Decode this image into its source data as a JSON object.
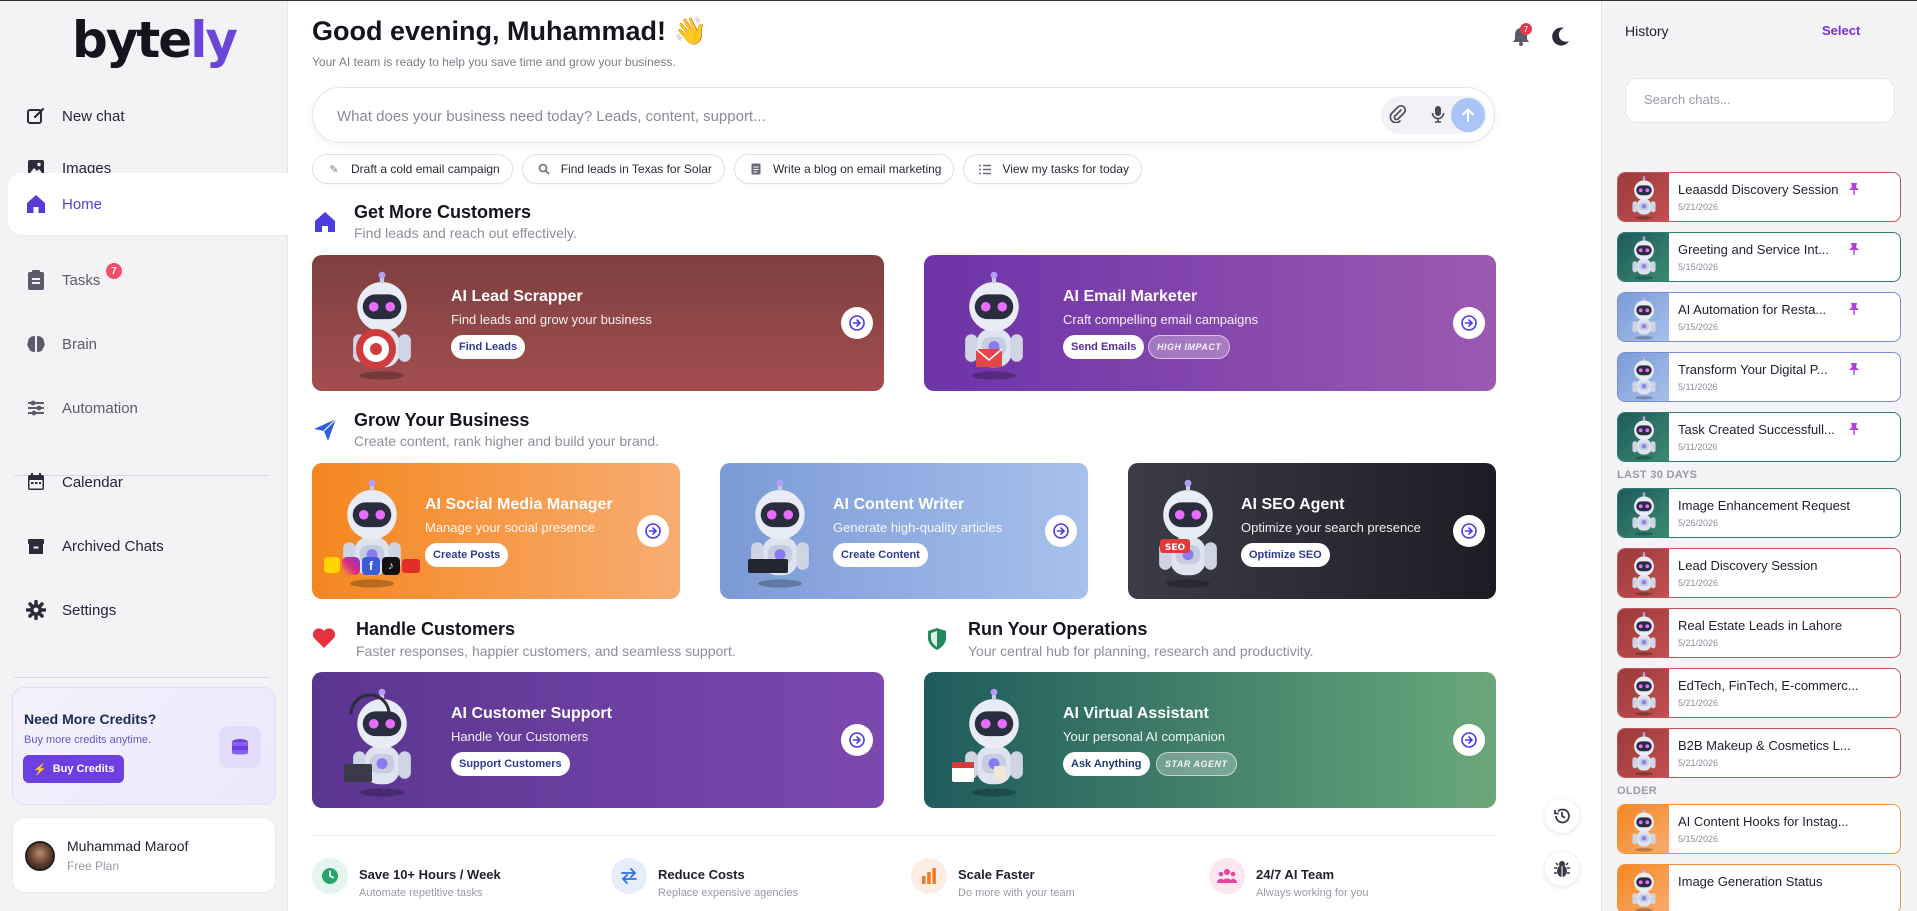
{
  "app": {
    "logo_main": "byte",
    "logo_accent": "ly"
  },
  "sidebar": {
    "items": [
      {
        "key": "new-chat",
        "label": "New chat"
      },
      {
        "key": "images",
        "label": "Images"
      },
      {
        "key": "home",
        "label": "Home",
        "active": true
      },
      {
        "key": "tasks",
        "label": "Tasks",
        "badge": "7"
      },
      {
        "key": "brain",
        "label": "Brain"
      },
      {
        "key": "automation",
        "label": "Automation"
      },
      {
        "key": "calendar",
        "label": "Calendar"
      },
      {
        "key": "archived",
        "label": "Archived Chats"
      },
      {
        "key": "settings",
        "label": "Settings"
      }
    ],
    "credits": {
      "title": "Need More Credits?",
      "subtitle": "Buy more credits anytime.",
      "button": "Buy Credits"
    },
    "profile": {
      "name": "Muhammad Maroof",
      "plan": "Free Plan"
    }
  },
  "header": {
    "greeting": "Good evening, Muhammad! 👋",
    "subtitle": "Your AI team is ready to help you save time and grow your business.",
    "notification_count": "7"
  },
  "search": {
    "placeholder": "What does your business need today? Leads, content, support..."
  },
  "chips": [
    {
      "icon": "pen-icon",
      "label": "Draft a cold email campaign"
    },
    {
      "icon": "search-icon",
      "label": "Find leads in Texas for Solar"
    },
    {
      "icon": "document-icon",
      "label": "Write a blog on email marketing"
    },
    {
      "icon": "list-icon",
      "label": "View my tasks for today"
    }
  ],
  "sections": {
    "customers": {
      "title": "Get More Customers",
      "subtitle": "Find leads and reach out effectively."
    },
    "grow": {
      "title": "Grow Your Business",
      "subtitle": "Create content, rank higher and build your brand."
    },
    "handle": {
      "title": "Handle Customers",
      "subtitle": "Faster responses, happier customers, and seamless support."
    },
    "operations": {
      "title": "Run Your Operations",
      "subtitle": "Your central hub for planning, research and productivity."
    }
  },
  "cards": {
    "lead": {
      "title": "AI Lead Scrapper",
      "subtitle": "Find leads and grow your business",
      "button": "Find Leads"
    },
    "email": {
      "title": "AI Email Marketer",
      "subtitle": "Craft compelling email campaigns",
      "button": "Send Emails",
      "badge": "HIGH IMPACT"
    },
    "social": {
      "title": "AI Social Media Manager",
      "subtitle": "Manage your social presence",
      "button": "Create Posts"
    },
    "content": {
      "title": "AI Content Writer",
      "subtitle": "Generate high-quality articles",
      "button": "Create Content"
    },
    "seo": {
      "title": "AI SEO Agent",
      "subtitle": "Optimize your search presence",
      "button": "Optimize SEO"
    },
    "support": {
      "title": "AI Customer Support",
      "subtitle": "Handle Your Customers",
      "button": "Support Customers"
    },
    "assistant": {
      "title": "AI Virtual Assistant",
      "subtitle": "Your personal AI companion",
      "button": "Ask Anything",
      "badge": "STAR AGENT"
    }
  },
  "benefits": [
    {
      "title": "Save 10+ Hours / Week",
      "subtitle": "Automate repetitive tasks"
    },
    {
      "title": "Reduce Costs",
      "subtitle": "Replace expensive agencies"
    },
    {
      "title": "Scale Faster",
      "subtitle": "Do more with your team"
    },
    {
      "title": "24/7 AI Team",
      "subtitle": "Always working for you"
    }
  ],
  "history": {
    "title": "History",
    "select": "Select",
    "search_placeholder": "Search chats...",
    "pinned": [
      {
        "title": "Leaasdd Discovery Session",
        "date": "5/21/2026",
        "theme": "red"
      },
      {
        "title": "Greeting and Service Int...",
        "date": "5/15/2026",
        "theme": "teal"
      },
      {
        "title": "AI Automation for Resta...",
        "date": "5/15/2026",
        "theme": "blue"
      },
      {
        "title": "Transform Your Digital P...",
        "date": "5/11/2026",
        "theme": "blue"
      },
      {
        "title": "Task Created Successfull...",
        "date": "5/11/2026",
        "theme": "teal"
      }
    ],
    "group_30": "LAST 30 DAYS",
    "last30": [
      {
        "title": "Image Enhancement Request",
        "date": "5/26/2026",
        "theme": "teal"
      },
      {
        "title": "Lead Discovery Session",
        "date": "5/21/2026",
        "theme": "red"
      },
      {
        "title": "Real Estate Leads in Lahore",
        "date": "5/21/2026",
        "theme": "red"
      },
      {
        "title": "EdTech, FinTech, E-commerc...",
        "date": "5/21/2026",
        "theme": "red"
      },
      {
        "title": "B2B Makeup & Cosmetics L...",
        "date": "5/21/2026",
        "theme": "red"
      }
    ],
    "group_older": "OLDER",
    "older": [
      {
        "title": "AI Content Hooks for Instag...",
        "date": "5/15/2026",
        "theme": "orange"
      },
      {
        "title": "Image Generation Status",
        "date": "",
        "theme": "orange"
      }
    ]
  },
  "colors": {
    "accent": "#5b3bd6",
    "lead_card": "#8a4646",
    "email_card": "#7b3fb0",
    "social_card": "#f6923a",
    "content_card": "#8eaee0",
    "seo_card": "#2c2c36",
    "support_card": "#6a3f9c",
    "assistant_card": "#2f7b6c"
  }
}
